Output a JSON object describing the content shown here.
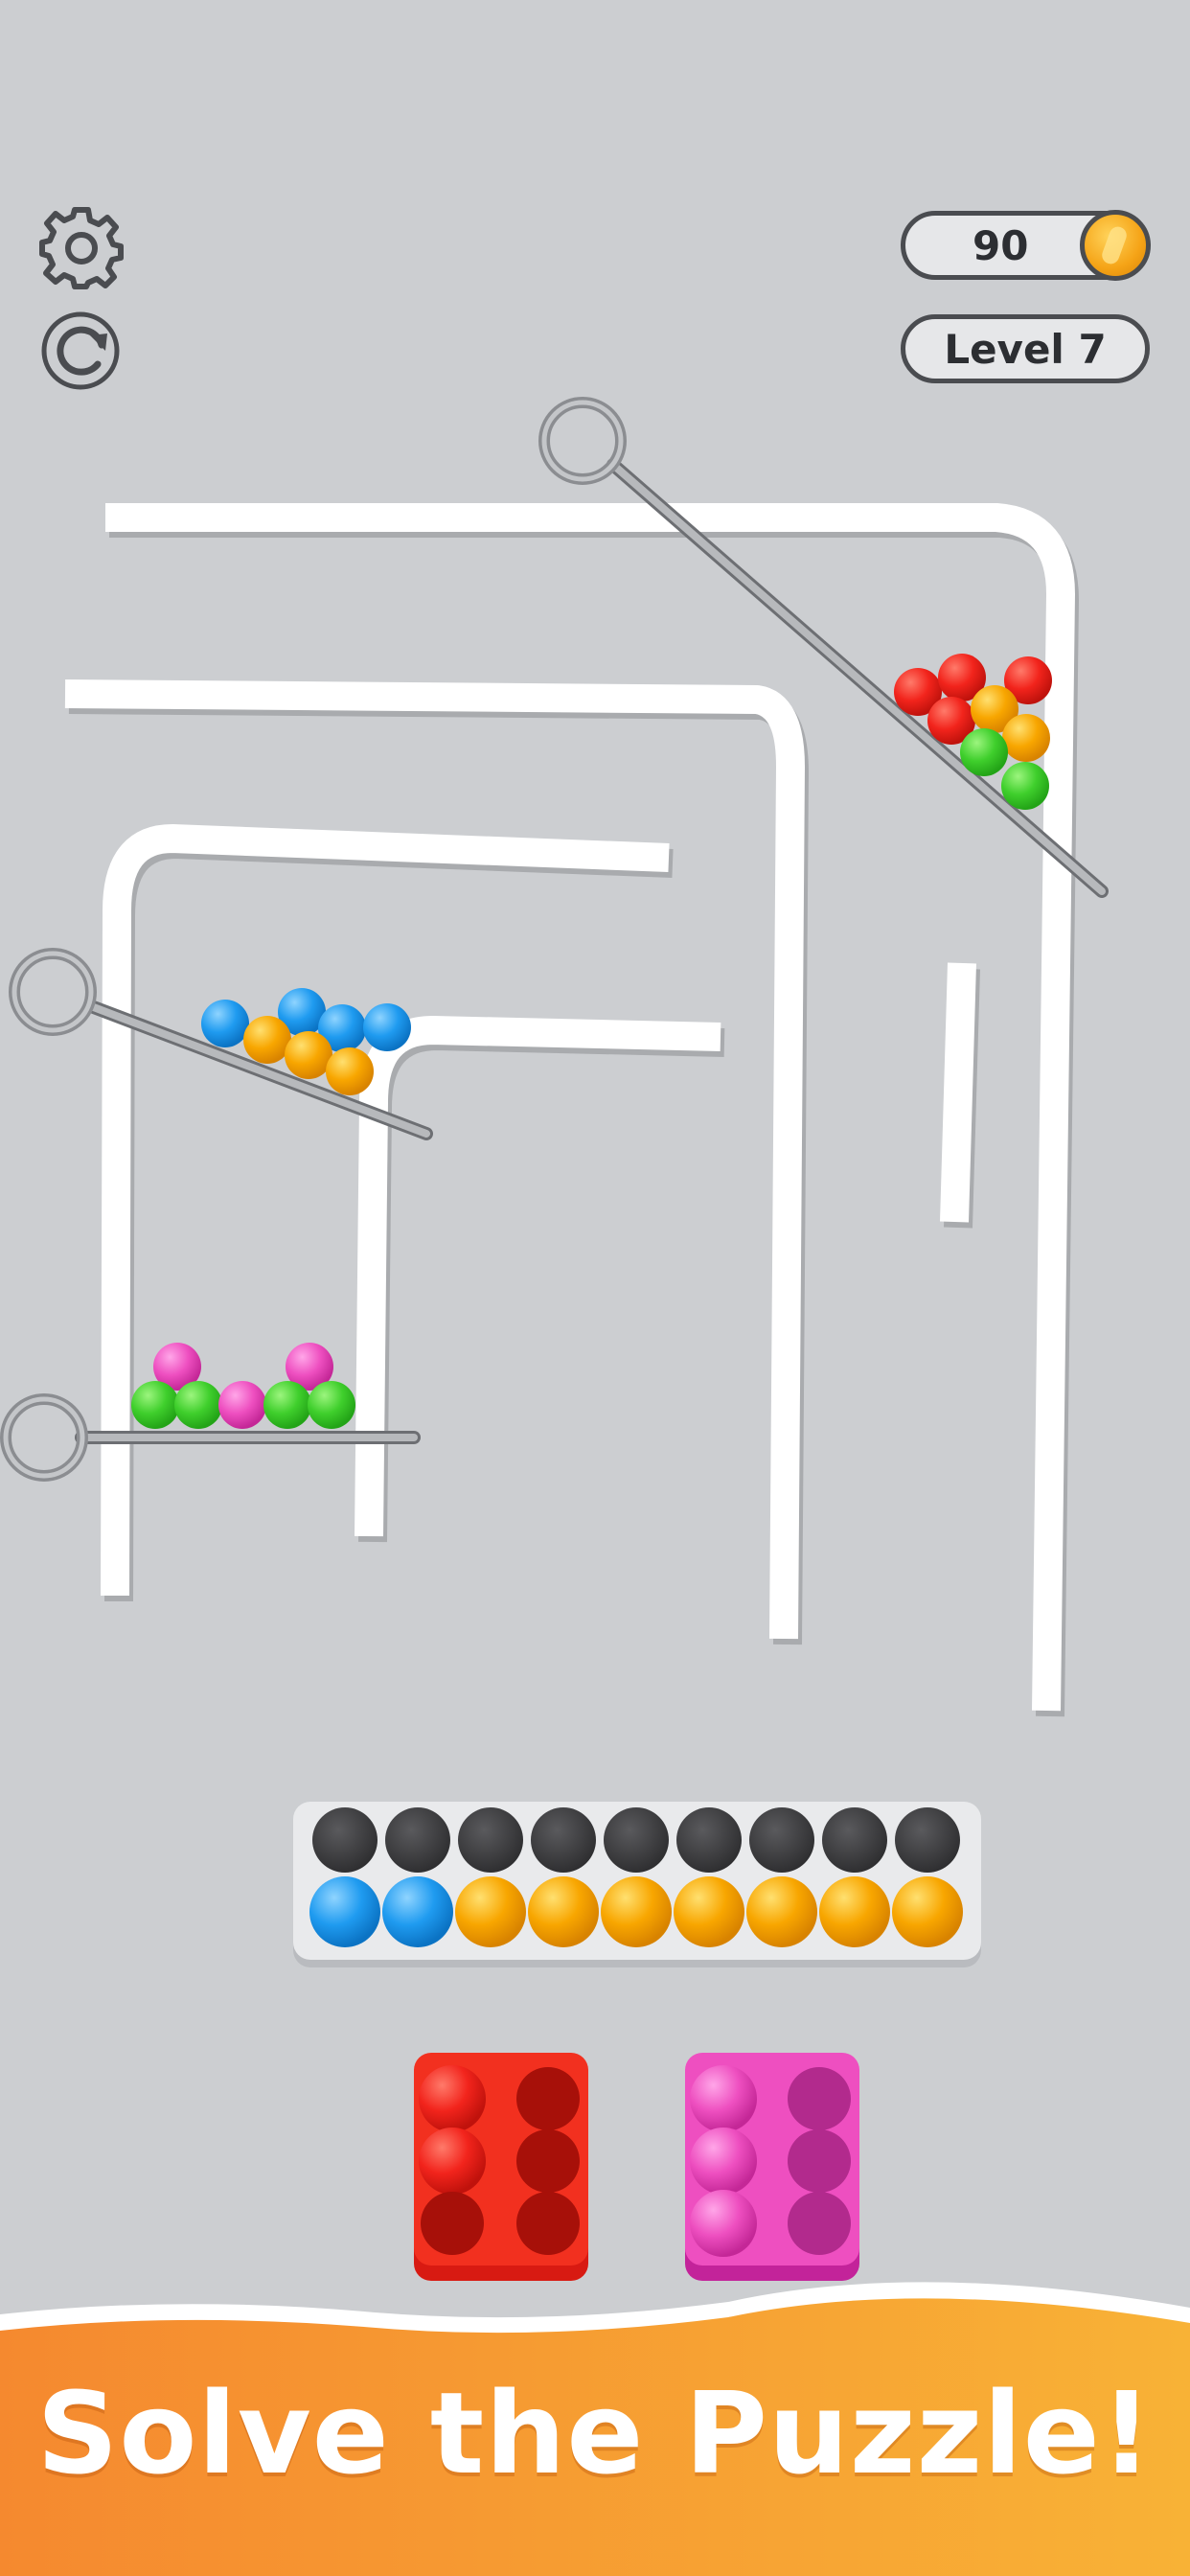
{
  "hud": {
    "coins": "90",
    "level_label": "Level 7"
  },
  "icons": {
    "settings": "gear-icon",
    "restart": "restart-icon",
    "coin": "coin-icon"
  },
  "colors": {
    "background": "#ccced1",
    "red": "#f2241c",
    "orange": "#f8a600",
    "green": "#3fcf2c",
    "blue": "#1f9bf0",
    "pink": "#ee4fc0",
    "slot_empty": "#3a3a3c",
    "banner_start": "#f5892f",
    "banner_end": "#f8b236"
  },
  "board": {
    "groups": [
      {
        "pin": "pin-top-right",
        "balls": [
          "red",
          "red",
          "red",
          "red",
          "orange",
          "orange",
          "green",
          "green"
        ]
      },
      {
        "pin": "pin-middle-left",
        "balls": [
          "blue",
          "blue",
          "blue",
          "blue",
          "orange",
          "orange",
          "orange"
        ]
      },
      {
        "pin": "pin-bottom-left",
        "balls": [
          "pink",
          "pink",
          "green",
          "green",
          "pink",
          "green",
          "green"
        ]
      }
    ]
  },
  "tray": {
    "top_row": [
      "empty",
      "empty",
      "empty",
      "empty",
      "empty",
      "empty",
      "empty",
      "empty",
      "empty"
    ],
    "bottom_row": [
      "blue",
      "blue",
      "orange",
      "orange",
      "orange",
      "orange",
      "orange",
      "orange",
      "orange"
    ]
  },
  "holders": [
    {
      "color": "red",
      "filled": 2,
      "capacity": 6
    },
    {
      "color": "pink",
      "filled": 3,
      "capacity": 6
    }
  ],
  "banner": {
    "text": "Solve the Puzzle!"
  }
}
